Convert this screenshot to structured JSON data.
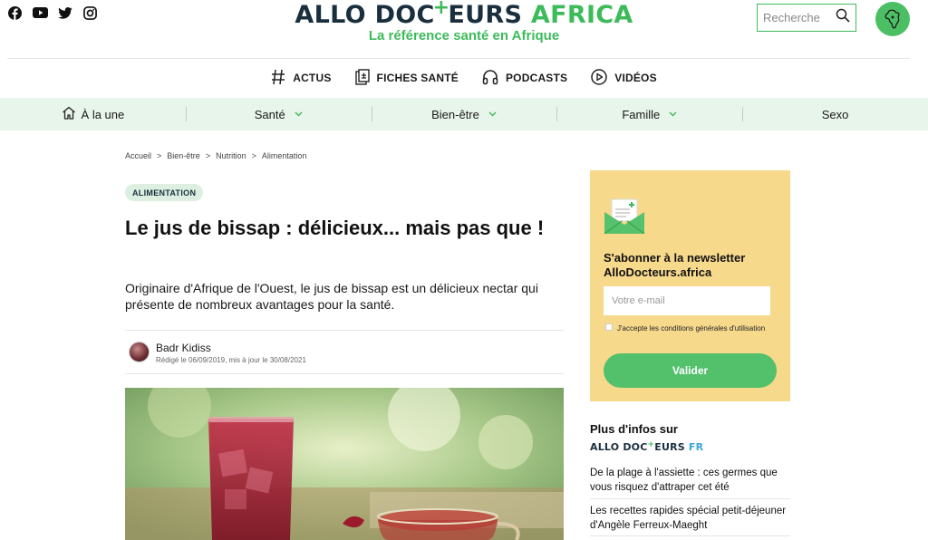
{
  "header": {
    "social": [
      "facebook-icon",
      "youtube-icon",
      "twitter-icon",
      "instagram-icon"
    ],
    "logo_part1": "ALLO DOC",
    "logo_plus": "+",
    "logo_part2": "EURS",
    "logo_part3": "AFRICA",
    "tagline": "La référence santé en Afrique",
    "search_placeholder": "Recherche",
    "colors": {
      "brand_dark": "#1a2f3e",
      "brand_green": "#3dbb5a",
      "nav_bg": "#e8f5ea",
      "newsletter_bg": "#f7d98c"
    }
  },
  "subnav": [
    {
      "label": "ACTUS",
      "icon": "hashtag-icon"
    },
    {
      "label": "FICHES SANTÉ",
      "icon": "document-icon"
    },
    {
      "label": "PODCASTS",
      "icon": "headphones-icon"
    },
    {
      "label": "VIDÉOS",
      "icon": "play-icon"
    }
  ],
  "categories": [
    {
      "label": "À la une",
      "icon": "home-icon"
    },
    {
      "label": "Santé",
      "dropdown": true
    },
    {
      "label": "Bien-être",
      "dropdown": true
    },
    {
      "label": "Famille",
      "dropdown": true
    },
    {
      "label": "Sexo"
    }
  ],
  "breadcrumb": [
    "Accueil",
    ">",
    "Bien-être",
    ">",
    "Nutrition",
    ">",
    "Alimentation"
  ],
  "article": {
    "tag": "ALIMENTATION",
    "title": "Le jus de bissap : délicieux... mais pas que !",
    "lead": "Originaire d'Afrique de l'Ouest, le jus de bissap est un délicieux nectar qui présente de nombreux avantages pour la santé.",
    "author": "Badr Kidiss",
    "dates": "Rédigé le 06/09/2019, mis à jour le 30/08/2021"
  },
  "newsletter": {
    "title": "S'abonner à la newsletter AlloDocteurs.africa",
    "email_placeholder": "Votre e-mail",
    "terms": "J'accepte les conditions générales d'utilisation",
    "button": "Valider"
  },
  "more": {
    "title": "Plus d'infos sur",
    "logo_a": "ALLO DOC",
    "logo_plus": "+",
    "logo_b": "EURS",
    "logo_fr": "FR",
    "links": [
      "De la plage à l'assiette : ces germes que vous risquez d'attraper cet été",
      "Les recettes rapides spécial petit-déjeuner d'Angèle Ferreux-Maeght"
    ]
  }
}
